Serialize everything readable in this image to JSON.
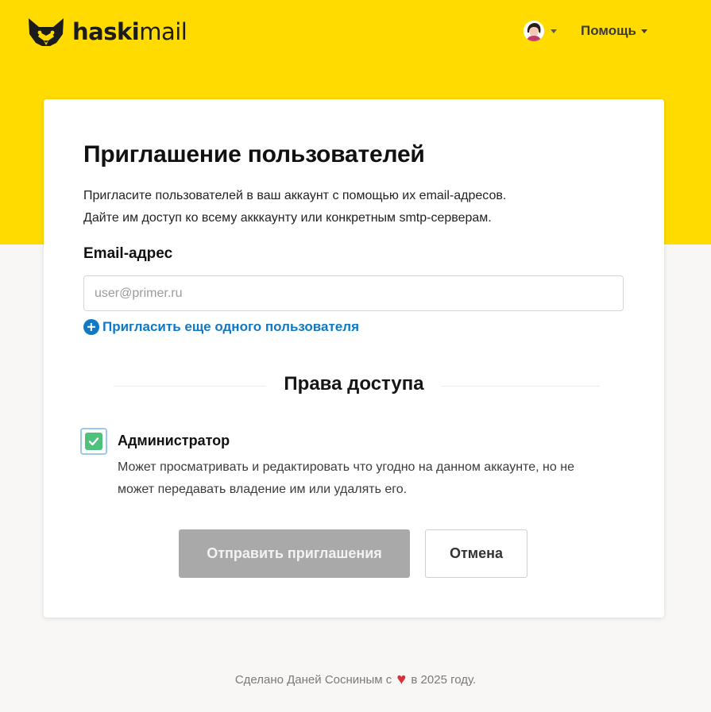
{
  "brand": {
    "name_bold": "haski",
    "name_light": "mail",
    "logo_icon": "husky-head-icon"
  },
  "header": {
    "user_menu_icon": "user-avatar",
    "help_label": "Помощь"
  },
  "form": {
    "title": "Приглашение пользователей",
    "description_line1": "Пригласите пользователей в ваш аккаунт с помощью их email-адресов.",
    "description_line2": "Дайте им доступ ко всему акккаунту или конкретным smtp-серверам.",
    "email_label": "Email-адрес",
    "email_value": "",
    "email_placeholder": "user@primer.ru",
    "invite_more_label": "Пригласить еще одного пользователя",
    "permissions_title": "Права доступа",
    "role": {
      "name": "Администратор",
      "checked": true,
      "description_line1": "Может просматривать и редактировать что угодно на данном аккаунте, но не",
      "description_line2": "может передавать владение им или удалять его."
    },
    "send_label": "Отправить приглашения",
    "cancel_label": "Отмена"
  },
  "footer": {
    "text_before": "Сделано Даней Сосниным с",
    "heart": "♥",
    "text_after": "в 2025 году."
  },
  "colors": {
    "brand_yellow": "#ffdb00",
    "link_blue": "#1079c5",
    "check_green": "#4ec17d",
    "disabled_button": "#a9a9a9",
    "heart_red": "#d9303c"
  }
}
